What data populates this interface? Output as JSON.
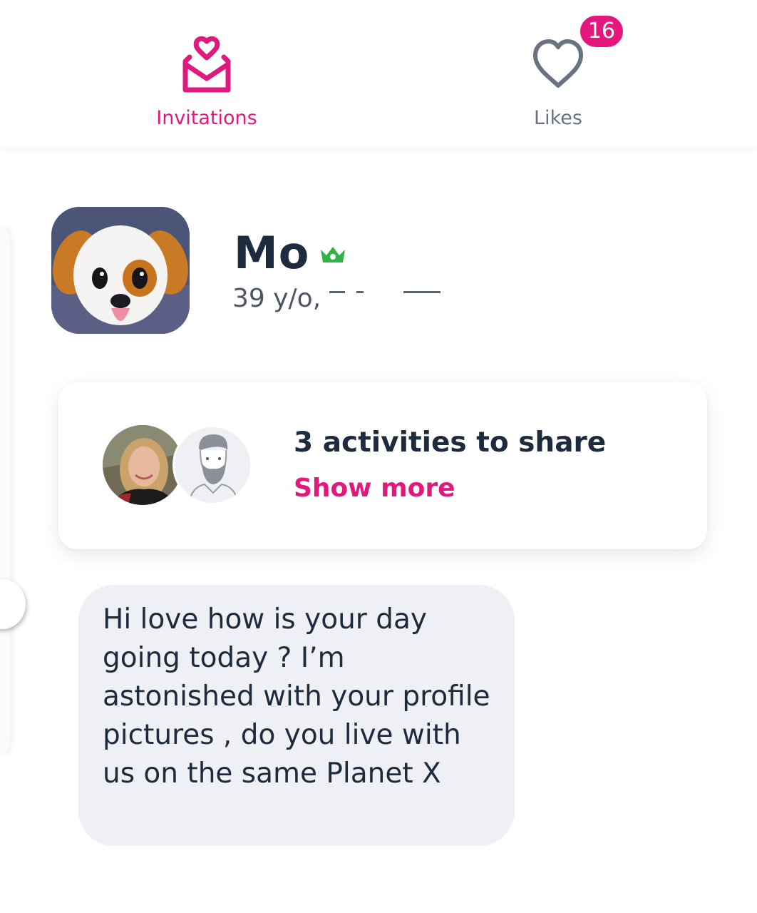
{
  "tabs": {
    "invitations": {
      "label": "Invitations",
      "icon": "envelope-heart-icon",
      "active": true
    },
    "likes": {
      "label": "Likes",
      "icon": "heart-outline-icon",
      "badge": "16"
    }
  },
  "profile": {
    "name": "Mo",
    "badge_icon": "crown-icon",
    "meta_visible": "39 y/o,",
    "avatar": "dog-emoji-avatar"
  },
  "activities": {
    "title": "3 activities to share",
    "action": "Show more",
    "avatars": [
      "woman-photo-avatar",
      "bearded-man-placeholder-avatar"
    ]
  },
  "message": {
    "text": "Hi love how is your day going today ? I’m astonished with your profile pictures , do you live with us on the same Planet X"
  },
  "colors": {
    "accent": "#e0197f",
    "text_dark": "#1e2a3d",
    "text_muted": "#6a7282",
    "bubble_bg": "#eef0f5",
    "crown": "#2fb344"
  }
}
